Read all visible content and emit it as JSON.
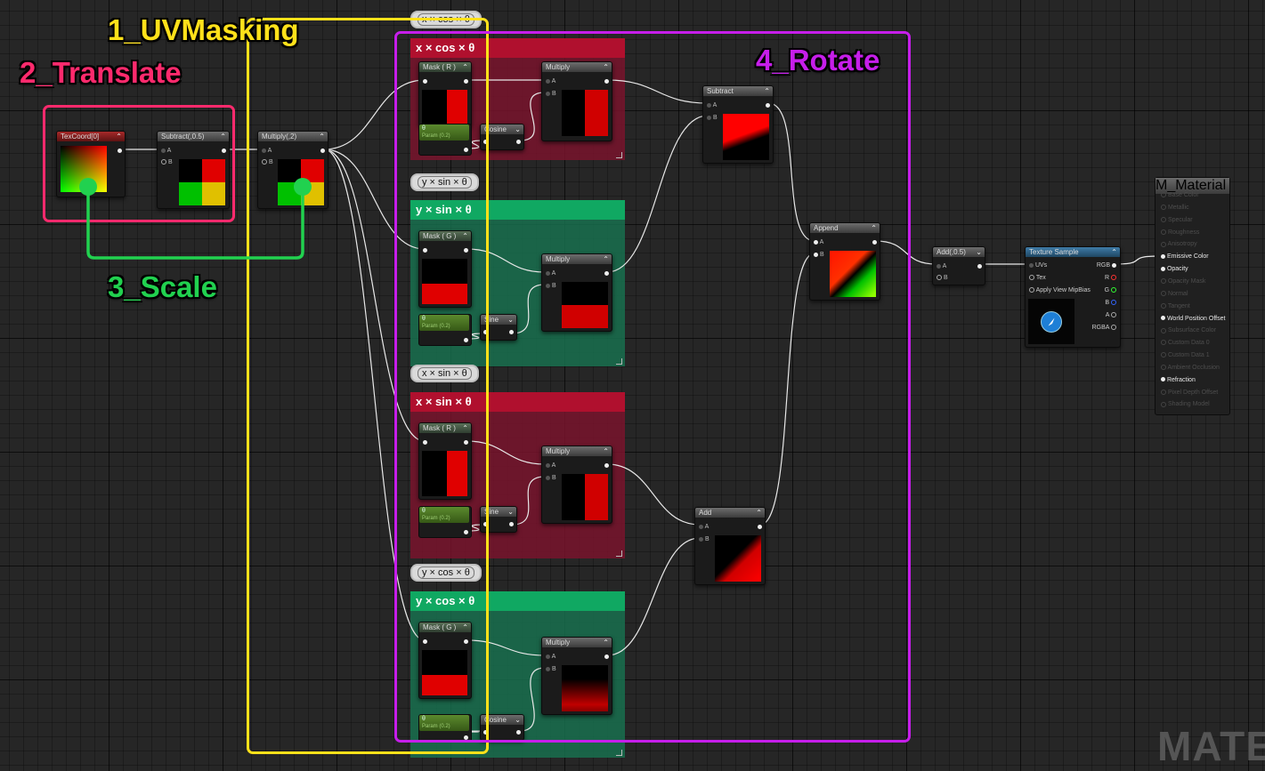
{
  "labels": {
    "uvmasking": "1_UVMasking",
    "translate": "2_Translate",
    "scale": "3_Scale",
    "rotate": "4_Rotate"
  },
  "colors": {
    "uvmasking": "#ffe11a",
    "translate": "#ff2a6d",
    "scale": "#21d14f",
    "rotate": "#c61eea"
  },
  "comments": [
    {
      "title": "x × cos × θ",
      "bubble": "x × cos × θ"
    },
    {
      "title": "y × sin × θ",
      "bubble": "y × sin × θ"
    },
    {
      "title": "x × sin × θ",
      "bubble": "x × sin × θ"
    },
    {
      "title": "y × cos × θ",
      "bubble": "y × cos × θ"
    }
  ],
  "nodes": {
    "texcoord": "TexCoord[0]",
    "subtract05": "Subtract(,0.5)",
    "multiply2": "Multiply(,2)",
    "mask_r": "Mask ( R )",
    "mask_g": "Mask ( G )",
    "multiply": "Multiply",
    "cosine": "Cosine",
    "sine": "Sine",
    "param_name": "θ",
    "param_value": "Param (0.2)",
    "subtract": "Subtract",
    "append": "Append",
    "add": "Add",
    "add05": "Add(,0.5)",
    "texture_sample": "Texture Sample",
    "pin_a": "A",
    "pin_b": "B"
  },
  "texture_sample_pins": {
    "inputs": [
      "UVs",
      "Tex",
      "Apply View MipBias"
    ],
    "outputs": [
      "RGB",
      "R",
      "G",
      "B",
      "A",
      "RGBA"
    ]
  },
  "material": {
    "title": "M_Material",
    "inputs": [
      {
        "label": "Base Color",
        "active": false
      },
      {
        "label": "Metallic",
        "active": false
      },
      {
        "label": "Specular",
        "active": false
      },
      {
        "label": "Roughness",
        "active": false
      },
      {
        "label": "Anisotropy",
        "active": false
      },
      {
        "label": "Emissive Color",
        "active": true
      },
      {
        "label": "Opacity",
        "active": true
      },
      {
        "label": "Opacity Mask",
        "active": false
      },
      {
        "label": "Normal",
        "active": false
      },
      {
        "label": "Tangent",
        "active": false
      },
      {
        "label": "World Position Offset",
        "active": true
      },
      {
        "label": "Subsurface Color",
        "active": false
      },
      {
        "label": "Custom Data 0",
        "active": false
      },
      {
        "label": "Custom Data 1",
        "active": false
      },
      {
        "label": "Ambient Occlusion",
        "active": false
      },
      {
        "label": "Refraction",
        "active": true
      },
      {
        "label": "Pixel Depth Offset",
        "active": false
      },
      {
        "label": "Shading Model",
        "active": false
      }
    ]
  },
  "watermark": "MATEI"
}
